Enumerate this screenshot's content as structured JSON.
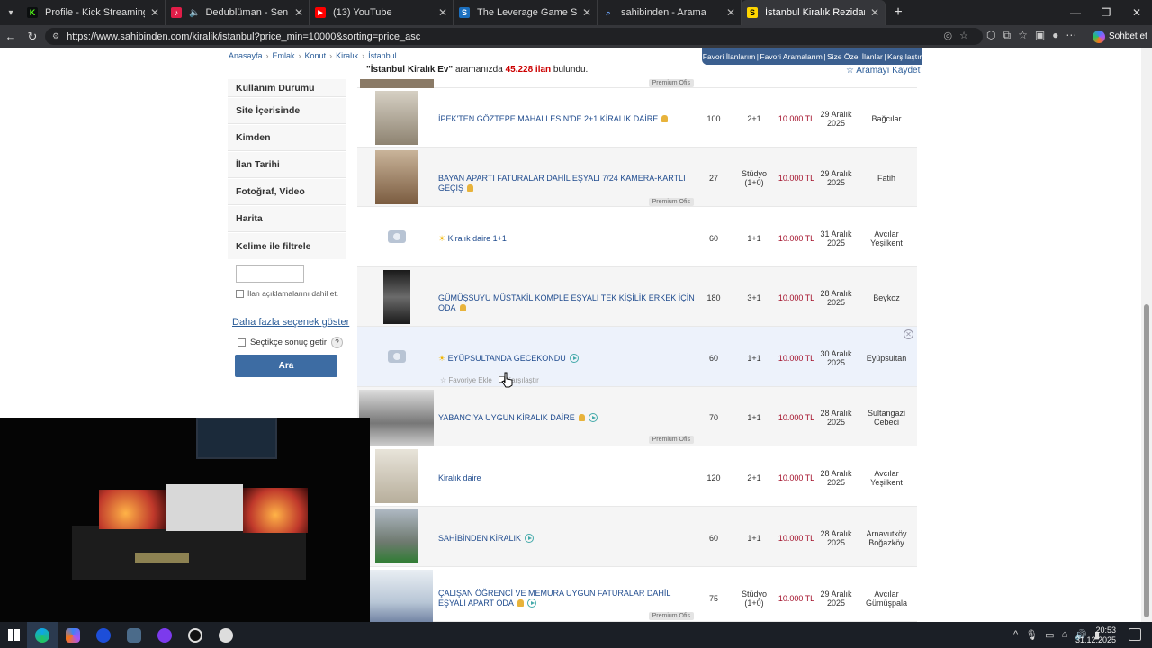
{
  "browser": {
    "tabs": [
      {
        "label": "Profile - Kick Streaming",
        "favicon_color": "#53fc18",
        "favicon_text": "K"
      },
      {
        "label": "Dedublüman - Sen Bilmezsin",
        "favicon_color": "#e11d48",
        "favicon_text": "♪"
      },
      {
        "label": "(13) YouTube",
        "favicon_color": "#ff0000",
        "favicon_text": "▶"
      },
      {
        "label": "The Leverage Game Steam'de",
        "favicon_color": "#1b6fbf",
        "favicon_text": "S"
      },
      {
        "label": "sahibinden - Arama",
        "favicon_color": "#3b82f6",
        "favicon_text": "⌕"
      },
      {
        "label": "İstanbul Kiralık Rezidans, Villa, Mü",
        "favicon_color": "#ffd500",
        "favicon_text": "S"
      }
    ],
    "url": "https://www.sahibinden.com/kiralik/istanbul?price_min=10000&sorting=price_asc",
    "copilot_label": "Sohbet et"
  },
  "breadcrumb": [
    "Anasayfa",
    "Emlak",
    "Konut",
    "Kiralık",
    "İstanbul"
  ],
  "fav_links": [
    "Favori İlanlarım",
    "Favori Aramalarım",
    "Size Özel İlanlar",
    "Karşılaştır"
  ],
  "results": {
    "query": "\"İstanbul Kiralık Ev\"",
    "mid": " aramanızda ",
    "count": "45.228 ilan",
    "tail": " bulundu.",
    "save_search": "Aramayı Kaydet"
  },
  "sidebar": {
    "filters": [
      "Kullanım Durumu",
      "Site İçerisinde",
      "Kimden",
      "İlan Tarihi",
      "Fotoğraf, Video",
      "Harita",
      "Kelime ile filtrele"
    ],
    "keyword_check": "İlan açıklamalarını dahil et.",
    "more_options": "Daha fazla seçenek göster",
    "instant_results": "Seçtikçe sonuç getir",
    "search_button": "Ara"
  },
  "listings": [
    {
      "title": "İPEK'TEN GÖZTEPE MAHALLESİN'DE 2+1 KİRALIK DAİRE",
      "m2": "100",
      "rooms": "2+1",
      "price": "10.000 TL",
      "date": "29 Aralık 2025",
      "location": "Bağcılar",
      "premium": ""
    },
    {
      "title": "BAYAN APARTI FATURALAR DAHİL EŞYALI 7/24 KAMERA-KARTLI GEÇİŞ",
      "m2": "27",
      "rooms": "Stüdyo (1+0)",
      "price": "10.000 TL",
      "date": "29 Aralık 2025",
      "location": "Fatih",
      "premium": "Premium Ofis"
    },
    {
      "title": "Kiralık daire 1+1",
      "m2": "60",
      "rooms": "1+1",
      "price": "10.000 TL",
      "date": "31 Aralık 2025",
      "location": "Avcılar Yeşilkent",
      "premium": ""
    },
    {
      "title": "GÜMÜŞSUYU MÜSTAKİL KOMPLE EŞYALI TEK KİŞİLİK ERKEK İÇİN ODA",
      "m2": "180",
      "rooms": "3+1",
      "price": "10.000 TL",
      "date": "28 Aralık 2025",
      "location": "Beykoz",
      "premium": ""
    },
    {
      "title": "EYÜPSULTANDA GECEKONDU",
      "m2": "60",
      "rooms": "1+1",
      "price": "10.000 TL",
      "date": "30 Aralık 2025",
      "location": "Eyüpsultan",
      "premium": ""
    },
    {
      "title": "YABANCIYA UYGUN KİRALIK DAİRE",
      "m2": "70",
      "rooms": "1+1",
      "price": "10.000 TL",
      "date": "28 Aralık 2025",
      "location": "Sultangazi Cebeci",
      "premium": "Premium Ofis"
    },
    {
      "title": "Kiralık daire",
      "m2": "120",
      "rooms": "2+1",
      "price": "10.000 TL",
      "date": "28 Aralık 2025",
      "location": "Avcılar Yeşilkent",
      "premium": ""
    },
    {
      "title": "SAHİBİNDEN KİRALIK",
      "m2": "60",
      "rooms": "1+1",
      "price": "10.000 TL",
      "date": "28 Aralık 2025",
      "location": "Arnavutköy Boğazköy",
      "premium": ""
    },
    {
      "title": "ÇALIŞAN ÖĞRENCİ VE MEMURA UYGUN FATURALAR DAHİL EŞYALI APART ODA",
      "m2": "75",
      "rooms": "Stüdyo (1+0)",
      "price": "10.000 TL",
      "date": "29 Aralık 2025",
      "location": "Avcılar Gümüşpala",
      "premium": "Premium Ofis"
    }
  ],
  "top_premium": "Premium Ofis",
  "row_actions": {
    "favorite": "Favoriye Ekle",
    "compare": "Karşılaştır"
  },
  "taskbar": {
    "time": "20:53",
    "date": "31.12.2025"
  }
}
